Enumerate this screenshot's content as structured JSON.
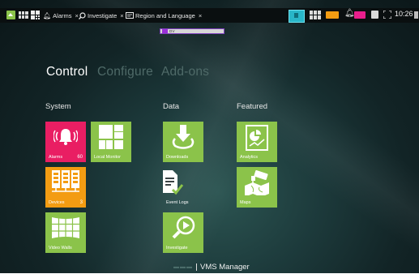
{
  "topbar": {
    "tabs": [
      {
        "label": "Alarms",
        "icon": "alarm-bell-icon"
      },
      {
        "label": "Investigate",
        "icon": "magnifier-icon"
      },
      {
        "label": "Region and Language",
        "icon": "region-language-icon"
      }
    ],
    "close_glyph": "×",
    "time": "10:26"
  },
  "banner": {
    "text": "DV"
  },
  "nav": {
    "tabs": [
      "Control",
      "Configure",
      "Add-ons"
    ],
    "active": "Control"
  },
  "sections": {
    "system": "System",
    "data": "Data",
    "featured": "Featured"
  },
  "tiles": {
    "alarms": {
      "label": "Alarms",
      "count": "60",
      "icon": "alarm-bell-icon",
      "color": "#e91e63"
    },
    "local_monitor": {
      "label": "Local Monitor",
      "icon": "grid-monitor-icon",
      "color": "#8bc34a"
    },
    "devices": {
      "label": "Devices",
      "count": "3",
      "icon": "devices-icon",
      "color": "#f39c12"
    },
    "video_walls": {
      "label": "Video Walls",
      "icon": "video-wall-icon",
      "color": "#8bc34a"
    },
    "downloads": {
      "label": "Downloads",
      "icon": "download-icon",
      "color": "#8bc34a"
    },
    "event_logs": {
      "label": "Event Logs",
      "icon": "event-log-icon",
      "color": "#8bc34a"
    },
    "investigate": {
      "label": "Investigate",
      "icon": "investigate-play-icon",
      "color": "#8bc34a"
    },
    "analytics": {
      "label": "Analytics",
      "icon": "analytics-icon",
      "color": "#8bc34a"
    },
    "maps": {
      "label": "Maps",
      "icon": "map-camera-icon",
      "color": "#8bc34a"
    }
  },
  "footer": {
    "product": "VMS Manager"
  }
}
